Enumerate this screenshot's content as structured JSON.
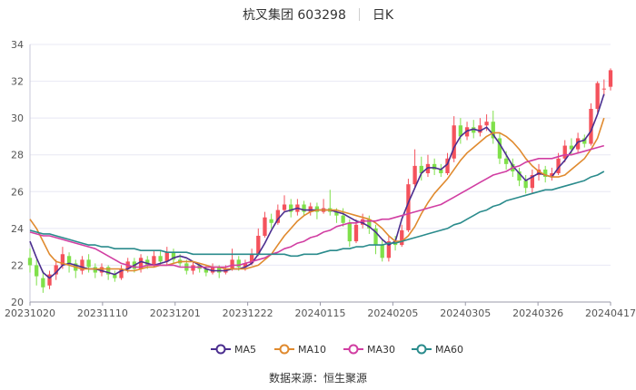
{
  "header": {
    "title": "杭叉集团 603298",
    "period": "日K"
  },
  "source": "数据来源：恒生聚源",
  "colors": {
    "up": "#f4525c",
    "down": "#7fe04a",
    "grid": "#e8e8f4",
    "axis": "#c8c8d8",
    "ma5": "#4b2e8f",
    "ma10": "#e08a2e",
    "ma30": "#d13ea2",
    "ma60": "#2a8b8c"
  },
  "chart_data": {
    "type": "candlestick",
    "title": "杭叉集团 603298 日K",
    "ylim": [
      20,
      34
    ],
    "yticks": [
      20,
      22,
      24,
      26,
      28,
      30,
      32,
      34
    ],
    "xticks": [
      "20231020",
      "20231110",
      "20231201",
      "20231222",
      "20240115",
      "20240205",
      "20240305",
      "20240326",
      "20240417"
    ],
    "legend_position": "bottom",
    "series": [
      {
        "name": "MA5",
        "color": "#4b2e8f",
        "values": [
          23.3,
          22.4,
          21.6,
          21.3,
          21.6,
          22.0,
          22.1,
          22.0,
          21.9,
          21.8,
          21.8,
          21.7,
          21.6,
          21.5,
          21.7,
          21.8,
          22.0,
          22.2,
          22.1,
          22.0,
          22.1,
          22.2,
          22.4,
          22.5,
          22.4,
          22.2,
          22.0,
          21.8,
          21.7,
          21.7,
          21.7,
          21.8,
          21.8,
          21.9,
          22.1,
          22.6,
          23.2,
          23.9,
          24.5,
          24.9,
          25.0,
          25.1,
          25.0,
          25.0,
          25.0,
          25.0,
          25.0,
          24.9,
          24.8,
          24.6,
          24.4,
          24.3,
          24.1,
          23.8,
          23.4,
          23.1,
          23.3,
          24.5,
          25.4,
          26.2,
          27.0,
          27.3,
          27.3,
          27.2,
          27.5,
          28.4,
          29.0,
          29.3,
          29.4,
          29.3,
          29.5,
          29.1,
          28.6,
          28.0,
          27.4,
          27.0,
          26.6,
          26.8,
          27.0,
          26.9,
          26.8,
          27.3,
          27.7,
          28.2,
          28.7,
          28.8,
          29.3,
          30.2,
          31.3
        ]
      },
      {
        "name": "MA10",
        "color": "#e08a2e",
        "values": [
          24.5,
          24.0,
          23.3,
          22.6,
          22.2,
          22.1,
          22.0,
          21.9,
          21.8,
          21.8,
          21.8,
          21.8,
          21.8,
          21.8,
          21.8,
          21.7,
          21.7,
          21.8,
          21.9,
          21.9,
          22.0,
          22.0,
          22.1,
          22.2,
          22.2,
          22.2,
          22.1,
          22.0,
          21.9,
          21.9,
          21.8,
          21.8,
          21.8,
          21.8,
          21.9,
          22.0,
          22.3,
          22.6,
          23.1,
          23.6,
          24.0,
          24.4,
          24.7,
          24.9,
          25.0,
          25.0,
          25.0,
          25.0,
          24.9,
          24.8,
          24.7,
          24.6,
          24.5,
          24.3,
          24.0,
          23.6,
          23.3,
          23.3,
          23.6,
          24.1,
          24.8,
          25.4,
          25.9,
          26.3,
          26.7,
          27.2,
          27.7,
          28.1,
          28.4,
          28.7,
          29.0,
          29.2,
          29.2,
          29.0,
          28.7,
          28.3,
          27.8,
          27.4,
          27.1,
          26.9,
          26.8,
          26.8,
          26.9,
          27.2,
          27.5,
          27.8,
          28.3,
          28.9,
          30.0
        ]
      },
      {
        "name": "MA30",
        "color": "#d13ea2",
        "values": [
          23.8,
          23.7,
          23.6,
          23.6,
          23.5,
          23.4,
          23.3,
          23.2,
          23.1,
          23.0,
          22.9,
          22.7,
          22.5,
          22.3,
          22.1,
          22.0,
          21.9,
          21.9,
          22.0,
          22.0,
          22.0,
          22.0,
          22.0,
          21.9,
          21.9,
          21.9,
          21.9,
          21.9,
          21.9,
          21.9,
          21.9,
          22.0,
          22.0,
          22.1,
          22.2,
          22.3,
          22.4,
          22.6,
          22.7,
          22.9,
          23.0,
          23.2,
          23.3,
          23.5,
          23.6,
          23.8,
          23.9,
          24.1,
          24.2,
          24.3,
          24.3,
          24.4,
          24.4,
          24.4,
          24.5,
          24.5,
          24.6,
          24.7,
          24.8,
          24.9,
          25.0,
          25.1,
          25.2,
          25.3,
          25.5,
          25.7,
          25.9,
          26.1,
          26.3,
          26.5,
          26.7,
          26.9,
          27.0,
          27.1,
          27.3,
          27.4,
          27.6,
          27.7,
          27.8,
          27.8,
          27.8,
          27.9,
          28.0,
          28.0,
          28.1,
          28.2,
          28.3,
          28.4,
          28.5
        ]
      },
      {
        "name": "MA60",
        "color": "#2a8b8c",
        "values": [
          23.9,
          23.8,
          23.7,
          23.7,
          23.6,
          23.5,
          23.4,
          23.3,
          23.2,
          23.1,
          23.1,
          23.0,
          23.0,
          22.9,
          22.9,
          22.9,
          22.9,
          22.8,
          22.8,
          22.8,
          22.8,
          22.7,
          22.7,
          22.7,
          22.7,
          22.6,
          22.6,
          22.6,
          22.6,
          22.6,
          22.6,
          22.6,
          22.6,
          22.6,
          22.6,
          22.6,
          22.6,
          22.6,
          22.6,
          22.6,
          22.5,
          22.5,
          22.6,
          22.6,
          22.6,
          22.7,
          22.8,
          22.8,
          22.9,
          22.9,
          23.0,
          23.0,
          23.1,
          23.1,
          23.1,
          23.2,
          23.2,
          23.3,
          23.4,
          23.5,
          23.6,
          23.7,
          23.8,
          23.9,
          24.0,
          24.2,
          24.3,
          24.5,
          24.7,
          24.9,
          25.0,
          25.2,
          25.3,
          25.5,
          25.6,
          25.7,
          25.8,
          25.9,
          26.0,
          26.1,
          26.1,
          26.2,
          26.3,
          26.4,
          26.5,
          26.6,
          26.8,
          26.9,
          27.1
        ]
      }
    ],
    "candles": [
      {
        "o": 22.4,
        "c": 22.0,
        "h": 22.9,
        "l": 21.6
      },
      {
        "o": 22.0,
        "c": 21.4,
        "h": 22.3,
        "l": 20.9
      },
      {
        "o": 21.3,
        "c": 20.8,
        "h": 21.7,
        "l": 20.5
      },
      {
        "o": 20.9,
        "c": 21.5,
        "h": 21.7,
        "l": 20.7
      },
      {
        "o": 21.5,
        "c": 22.0,
        "h": 22.3,
        "l": 21.2
      },
      {
        "o": 22.0,
        "c": 22.6,
        "h": 23.0,
        "l": 21.8
      },
      {
        "o": 22.5,
        "c": 22.1,
        "h": 22.7,
        "l": 21.6
      },
      {
        "o": 22.1,
        "c": 21.7,
        "h": 22.3,
        "l": 21.3
      },
      {
        "o": 21.7,
        "c": 22.3,
        "h": 22.5,
        "l": 21.5
      },
      {
        "o": 22.3,
        "c": 21.9,
        "h": 22.6,
        "l": 21.6
      },
      {
        "o": 21.9,
        "c": 21.6,
        "h": 22.1,
        "l": 21.3
      },
      {
        "o": 21.6,
        "c": 21.9,
        "h": 22.1,
        "l": 21.4
      },
      {
        "o": 21.9,
        "c": 21.5,
        "h": 22.0,
        "l": 21.2
      },
      {
        "o": 21.5,
        "c": 21.3,
        "h": 21.7,
        "l": 21.1
      },
      {
        "o": 21.3,
        "c": 21.8,
        "h": 22.0,
        "l": 21.2
      },
      {
        "o": 21.8,
        "c": 22.2,
        "h": 22.4,
        "l": 21.6
      },
      {
        "o": 22.2,
        "c": 21.8,
        "h": 22.4,
        "l": 21.6
      },
      {
        "o": 21.8,
        "c": 22.4,
        "h": 22.6,
        "l": 21.6
      },
      {
        "o": 22.3,
        "c": 22.0,
        "h": 22.5,
        "l": 21.8
      },
      {
        "o": 22.0,
        "c": 22.5,
        "h": 22.8,
        "l": 21.9
      },
      {
        "o": 22.5,
        "c": 22.2,
        "h": 22.8,
        "l": 22.0
      },
      {
        "o": 22.2,
        "c": 22.7,
        "h": 23.0,
        "l": 22.0
      },
      {
        "o": 22.7,
        "c": 22.3,
        "h": 22.9,
        "l": 22.1
      },
      {
        "o": 22.3,
        "c": 22.1,
        "h": 22.6,
        "l": 21.9
      },
      {
        "o": 22.1,
        "c": 21.7,
        "h": 22.3,
        "l": 21.5
      },
      {
        "o": 21.7,
        "c": 22.0,
        "h": 22.2,
        "l": 21.5
      },
      {
        "o": 22.0,
        "c": 21.8,
        "h": 22.1,
        "l": 21.6
      },
      {
        "o": 21.8,
        "c": 21.6,
        "h": 22.0,
        "l": 21.4
      },
      {
        "o": 21.6,
        "c": 21.9,
        "h": 22.1,
        "l": 21.5
      },
      {
        "o": 21.9,
        "c": 21.6,
        "h": 22.0,
        "l": 21.3
      },
      {
        "o": 21.6,
        "c": 21.8,
        "h": 22.0,
        "l": 21.5
      },
      {
        "o": 21.8,
        "c": 22.3,
        "h": 22.9,
        "l": 21.7
      },
      {
        "o": 22.3,
        "c": 21.9,
        "h": 22.5,
        "l": 21.7
      },
      {
        "o": 21.9,
        "c": 22.1,
        "h": 22.3,
        "l": 21.7
      },
      {
        "o": 22.1,
        "c": 22.6,
        "h": 22.9,
        "l": 22.0
      },
      {
        "o": 22.6,
        "c": 23.6,
        "h": 24.0,
        "l": 22.5
      },
      {
        "o": 23.6,
        "c": 24.6,
        "h": 24.9,
        "l": 23.5
      },
      {
        "o": 24.5,
        "c": 24.3,
        "h": 24.8,
        "l": 24.0
      },
      {
        "o": 24.3,
        "c": 25.0,
        "h": 25.3,
        "l": 24.2
      },
      {
        "o": 25.0,
        "c": 25.3,
        "h": 25.8,
        "l": 24.9
      },
      {
        "o": 25.3,
        "c": 24.9,
        "h": 25.6,
        "l": 24.6
      },
      {
        "o": 24.9,
        "c": 25.3,
        "h": 25.6,
        "l": 24.7
      },
      {
        "o": 25.3,
        "c": 24.9,
        "h": 25.5,
        "l": 24.7
      },
      {
        "o": 24.9,
        "c": 25.2,
        "h": 25.4,
        "l": 24.7
      },
      {
        "o": 25.2,
        "c": 24.9,
        "h": 25.4,
        "l": 24.5
      },
      {
        "o": 24.9,
        "c": 25.1,
        "h": 25.6,
        "l": 24.8
      },
      {
        "o": 25.1,
        "c": 24.9,
        "h": 26.1,
        "l": 24.7
      },
      {
        "o": 24.9,
        "c": 24.7,
        "h": 25.1,
        "l": 24.3
      },
      {
        "o": 24.7,
        "c": 24.3,
        "h": 25.1,
        "l": 24.1
      },
      {
        "o": 24.3,
        "c": 23.3,
        "h": 24.5,
        "l": 23.0
      },
      {
        "o": 23.3,
        "c": 24.2,
        "h": 24.5,
        "l": 23.2
      },
      {
        "o": 24.2,
        "c": 24.5,
        "h": 24.8,
        "l": 24.0
      },
      {
        "o": 24.5,
        "c": 24.0,
        "h": 24.7,
        "l": 23.7
      },
      {
        "o": 24.0,
        "c": 23.1,
        "h": 24.2,
        "l": 22.6
      },
      {
        "o": 23.1,
        "c": 22.4,
        "h": 23.4,
        "l": 22.2
      },
      {
        "o": 22.4,
        "c": 23.3,
        "h": 23.6,
        "l": 22.2
      },
      {
        "o": 23.3,
        "c": 23.1,
        "h": 23.6,
        "l": 22.8
      },
      {
        "o": 23.1,
        "c": 23.9,
        "h": 24.2,
        "l": 23.0
      },
      {
        "o": 23.9,
        "c": 26.4,
        "h": 26.7,
        "l": 23.8
      },
      {
        "o": 26.4,
        "c": 27.4,
        "h": 28.3,
        "l": 26.2
      },
      {
        "o": 27.4,
        "c": 27.0,
        "h": 27.9,
        "l": 26.6
      },
      {
        "o": 27.0,
        "c": 27.5,
        "h": 28.0,
        "l": 26.8
      },
      {
        "o": 27.5,
        "c": 27.2,
        "h": 27.8,
        "l": 26.9
      },
      {
        "o": 27.2,
        "c": 27.0,
        "h": 27.5,
        "l": 26.8
      },
      {
        "o": 27.0,
        "c": 27.8,
        "h": 28.1,
        "l": 26.9
      },
      {
        "o": 27.8,
        "c": 29.6,
        "h": 30.1,
        "l": 27.6
      },
      {
        "o": 29.6,
        "c": 29.0,
        "h": 30.0,
        "l": 28.6
      },
      {
        "o": 29.0,
        "c": 29.5,
        "h": 29.8,
        "l": 28.8
      },
      {
        "o": 29.5,
        "c": 29.2,
        "h": 29.9,
        "l": 28.9
      },
      {
        "o": 29.2,
        "c": 29.6,
        "h": 30.0,
        "l": 29.0
      },
      {
        "o": 29.6,
        "c": 29.8,
        "h": 30.2,
        "l": 29.3
      },
      {
        "o": 29.8,
        "c": 28.9,
        "h": 30.4,
        "l": 28.6
      },
      {
        "o": 28.9,
        "c": 27.8,
        "h": 29.2,
        "l": 27.5
      },
      {
        "o": 27.8,
        "c": 27.5,
        "h": 28.2,
        "l": 27.2
      },
      {
        "o": 27.5,
        "c": 27.1,
        "h": 27.8,
        "l": 26.8
      },
      {
        "o": 27.1,
        "c": 26.6,
        "h": 27.3,
        "l": 26.3
      },
      {
        "o": 26.6,
        "c": 26.2,
        "h": 26.9,
        "l": 25.9
      },
      {
        "o": 26.2,
        "c": 26.9,
        "h": 27.2,
        "l": 25.9
      },
      {
        "o": 26.9,
        "c": 27.2,
        "h": 27.5,
        "l": 26.6
      },
      {
        "o": 27.2,
        "c": 26.8,
        "h": 27.4,
        "l": 26.5
      },
      {
        "o": 26.8,
        "c": 27.0,
        "h": 27.3,
        "l": 26.6
      },
      {
        "o": 27.0,
        "c": 27.8,
        "h": 28.1,
        "l": 26.9
      },
      {
        "o": 27.8,
        "c": 28.5,
        "h": 28.8,
        "l": 27.6
      },
      {
        "o": 28.5,
        "c": 28.3,
        "h": 28.9,
        "l": 28.0
      },
      {
        "o": 28.3,
        "c": 28.9,
        "h": 29.2,
        "l": 28.1
      },
      {
        "o": 28.9,
        "c": 28.6,
        "h": 29.1,
        "l": 28.4
      },
      {
        "o": 28.6,
        "c": 30.5,
        "h": 30.8,
        "l": 28.5
      },
      {
        "o": 30.5,
        "c": 31.9,
        "h": 32.0,
        "l": 30.3
      },
      {
        "o": 31.6,
        "c": 31.6,
        "h": 32.1,
        "l": 31.2
      },
      {
        "o": 31.7,
        "c": 32.6,
        "h": 32.7,
        "l": 31.5
      }
    ]
  }
}
